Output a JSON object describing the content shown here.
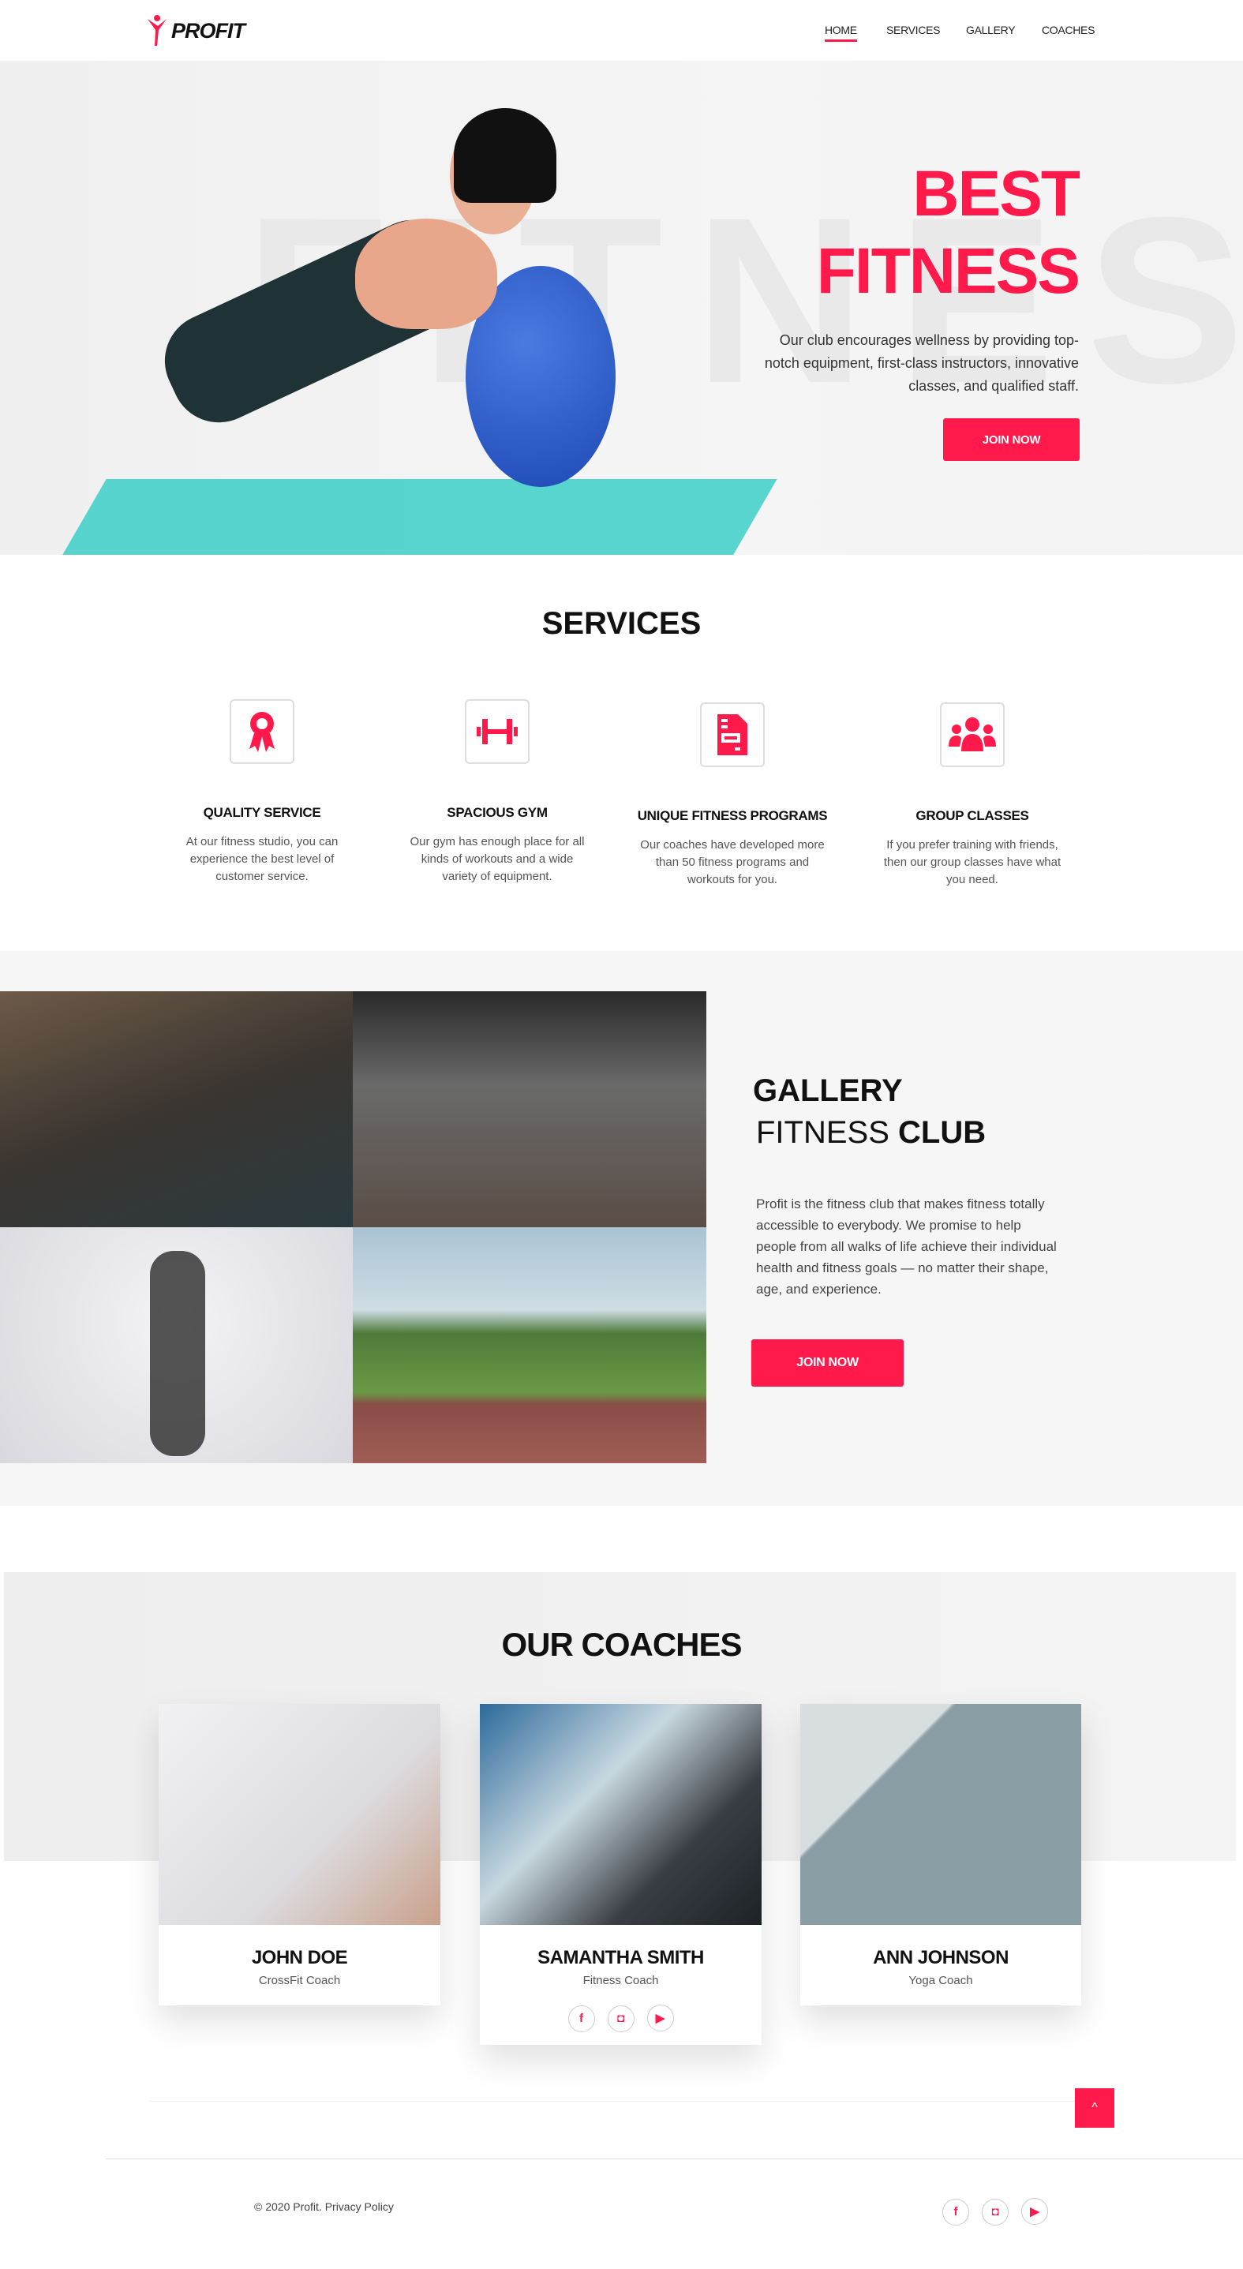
{
  "brand": {
    "name": "PROFIT",
    "accent": "#ff1a4b"
  },
  "nav": {
    "items": [
      {
        "label": "HOME",
        "active": true
      },
      {
        "label": "SERVICES"
      },
      {
        "label": "GALLERY"
      },
      {
        "label": "COACHES"
      }
    ]
  },
  "hero": {
    "bg_word": "FITNESS",
    "title_line1": "BEST",
    "title_line2": "FITNESS",
    "description": "Our club encourages wellness by providing top-notch equipment, first-class instructors, innovative classes, and qualified staff.",
    "button": "JOIN NOW"
  },
  "services": {
    "title": "SERVICES",
    "items": [
      {
        "icon": "award-ribbon-icon",
        "title": "QUALITY SERVICE",
        "desc": "At our fitness studio, you can experience the best level of customer service."
      },
      {
        "icon": "dumbbell-icon",
        "title": "SPACIOUS GYM",
        "desc": "Our gym has enough place for all kinds of workouts and a wide variety of equipment."
      },
      {
        "icon": "document-icon",
        "title": "UNIQUE FITNESS PROGRAMS",
        "desc": "Our coaches have developed more than 50 fitness programs and workouts for you."
      },
      {
        "icon": "group-icon",
        "title": "GROUP CLASSES",
        "desc": "If you prefer training with friends, then our group classes have what you need."
      }
    ]
  },
  "gallery": {
    "title": "GALLERY",
    "subtitle_light": "FITNESS",
    "subtitle_bold": "CLUB",
    "description": "Profit is the fitness club that makes fitness totally accessible to everybody. We promise to help people from all walks of life achieve their individual health and fitness goals — no matter their shape, age, and experience.",
    "button": "JOIN NOW"
  },
  "coaches": {
    "title": "OUR COACHES",
    "items": [
      {
        "name": "JOHN DOE",
        "role": "CrossFit Coach"
      },
      {
        "name": "SAMANTHA SMITH",
        "role": "Fitness Coach",
        "social": [
          "f",
          "◘",
          "▶"
        ]
      },
      {
        "name": "ANN JOHNSON",
        "role": "Yoga Coach"
      }
    ]
  },
  "footer": {
    "copyright": "©  2020 Profit. Privacy Policy",
    "social": [
      "f",
      "◘",
      "▶"
    ]
  },
  "back_to_top": "^"
}
